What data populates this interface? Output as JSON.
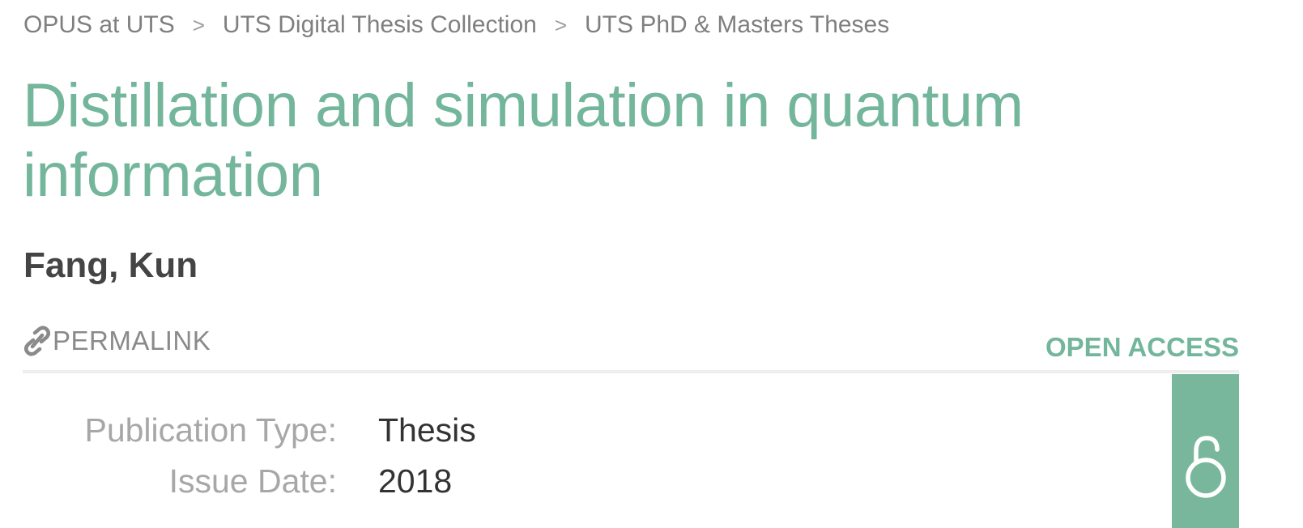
{
  "breadcrumb": {
    "items": [
      "OPUS at UTS",
      "UTS Digital Thesis Collection",
      "UTS PhD & Masters Theses"
    ],
    "separator": ">"
  },
  "record": {
    "title": "Distillation and simulation in quantum information",
    "author": "Fang, Kun",
    "permalink_label": "PERMALINK",
    "open_access_label": "OPEN ACCESS"
  },
  "metadata": [
    {
      "label": "Publication Type:",
      "value": "Thesis"
    },
    {
      "label": "Issue Date:",
      "value": "2018"
    }
  ],
  "icons": {
    "permalink": "link-icon",
    "open_access": "open-access-lock-icon"
  },
  "colors": {
    "accent": "#73b69c",
    "badge": "#78b79c",
    "muted_text": "#7f7f7f",
    "author_text": "#444444"
  }
}
